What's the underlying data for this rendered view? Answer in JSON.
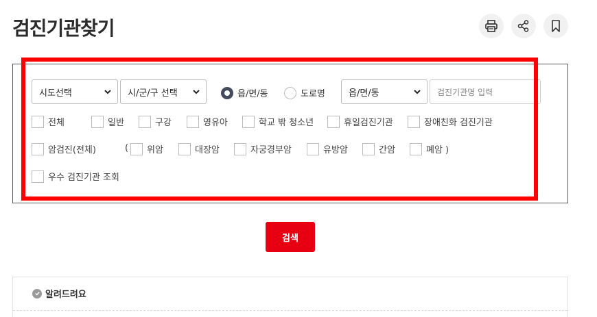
{
  "page": {
    "title": "검진기관찾기"
  },
  "toolbar": {
    "icons": [
      "printer-icon",
      "share-icon",
      "bookmark-icon"
    ]
  },
  "filters": {
    "sido": "시도선택",
    "sigungu": "시/군/구 선택",
    "radio": [
      {
        "label": "읍/면/동",
        "selected": true
      },
      {
        "label": "도로명",
        "selected": false
      }
    ],
    "emd": "읍/면/동",
    "name_placeholder": "검진기관명 입력",
    "row1": [
      "전체",
      "일반",
      "구강",
      "영유아",
      "학교 밖 청소년",
      "휴일검진기관",
      "장애친화 검진기관"
    ],
    "cancer_all": "암검진(전체)",
    "paren_open": "(",
    "cancers": [
      "위암",
      "대장암",
      "자궁경부암",
      "유방암",
      "간암",
      "폐암 )"
    ],
    "excellent": "우수 검진기관 조회"
  },
  "search_button": "검색",
  "notice": {
    "title": "알려드려요"
  },
  "colors": {
    "accent": "#e60012",
    "highlight": "#ff0000"
  }
}
